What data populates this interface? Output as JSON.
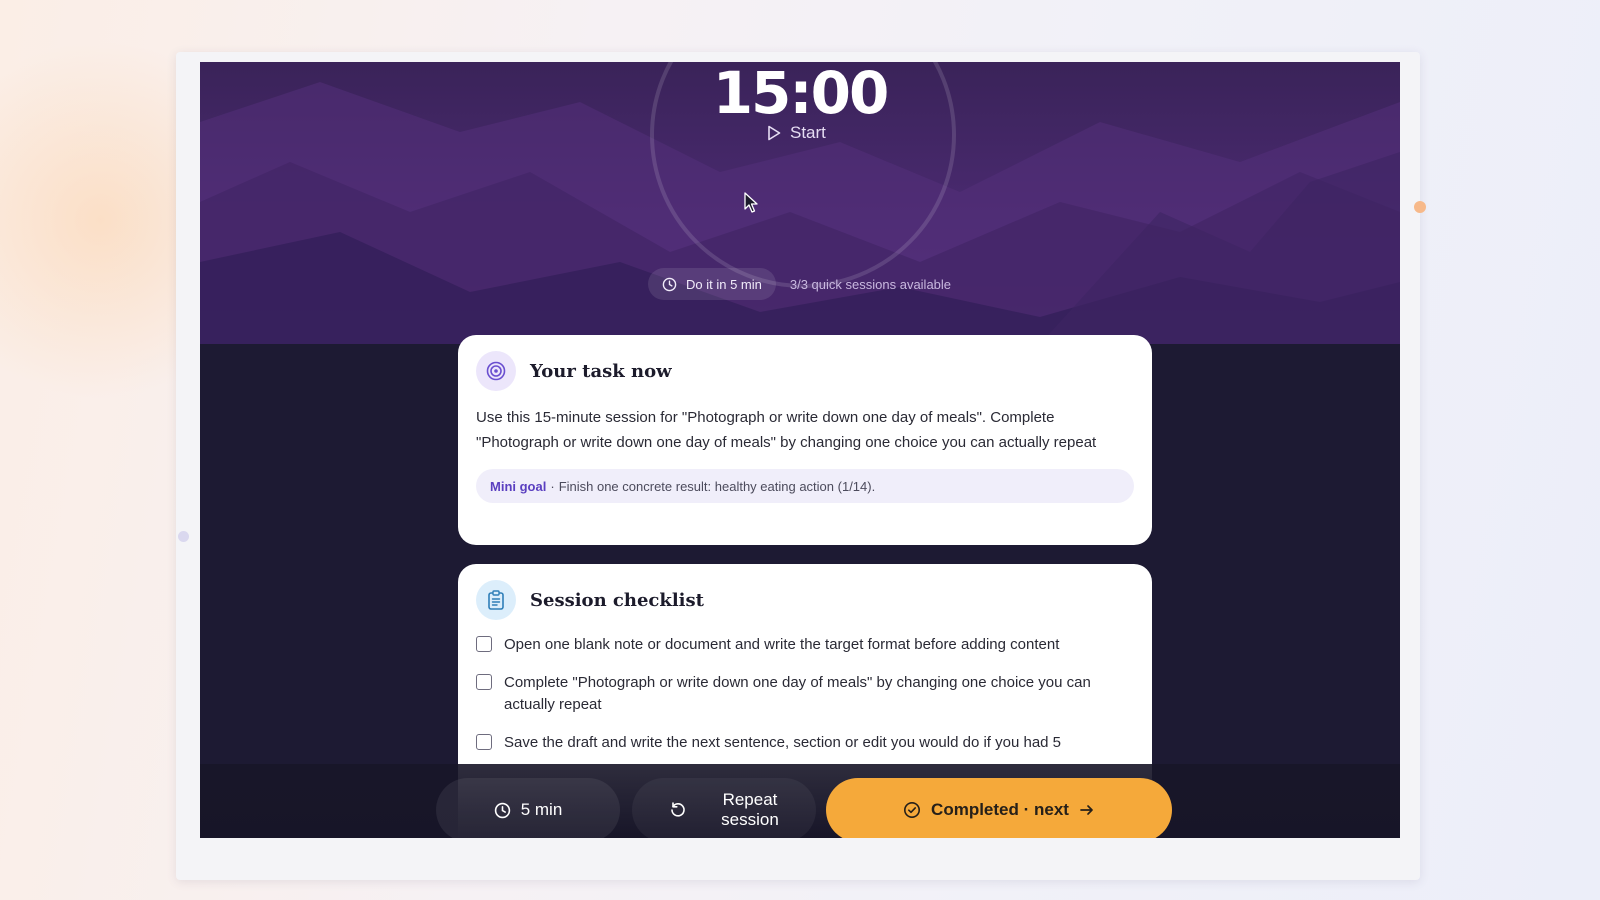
{
  "hero": {
    "timer": "15:00",
    "start_label": "Start",
    "quick_pill_label": "Do it in 5 min",
    "quick_note": "3/3 quick sessions available"
  },
  "task_card": {
    "title": "Your task now",
    "icon": "target-icon",
    "text": "Use this 15-minute session for \"Photograph or write down one day of meals\". Complete \"Photograph or write down one day of meals\" by changing one choice you can actually repeat",
    "mini_goal_label": "Mini goal",
    "mini_goal_separator": "·",
    "mini_goal_text": "Finish one concrete result: healthy eating action (1/14)."
  },
  "checklist_card": {
    "title": "Session checklist",
    "icon": "clipboard-icon",
    "items": [
      {
        "text": "Open one blank note or document and write the target format before adding content",
        "checked": false
      },
      {
        "text": "Complete \"Photograph or write down one day of meals\" by changing one choice you can actually repeat",
        "checked": false
      },
      {
        "text": "Save the draft and write the next sentence, section or edit you would do if you had 5",
        "checked": false
      }
    ]
  },
  "bottom_bar": {
    "min_label": "5 min",
    "repeat_label_line1": "Repeat",
    "repeat_label_line2": "session",
    "done_label": "Completed · next"
  },
  "colors": {
    "accent_orange": "#f5a93a",
    "hero_purple": "#4a2a70",
    "mini_goal_purple": "#5a3fc0",
    "screen_dark": "#1d1a33"
  }
}
